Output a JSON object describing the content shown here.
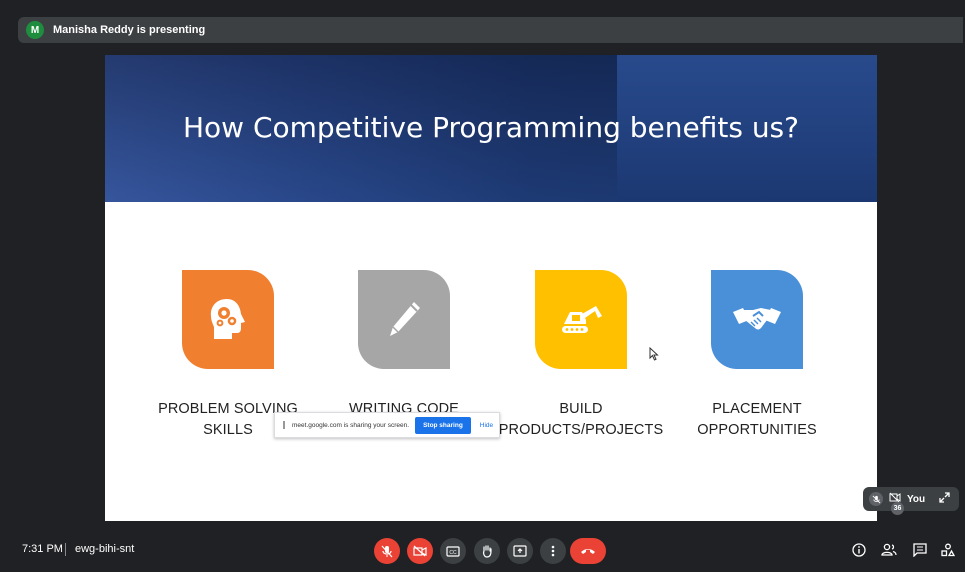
{
  "presenter": {
    "initial": "M",
    "text": "Manisha Reddy is presenting"
  },
  "slide": {
    "title": "How Competitive Programming benefits us?",
    "benefits": [
      {
        "line1": "PROBLEM SOLVING",
        "line2": "SKILLS",
        "icon": "head-gears-icon",
        "color": "#f08030"
      },
      {
        "line1": "WRITING CODE",
        "line2": "",
        "icon": "pencil-icon",
        "color": "#a6a6a6"
      },
      {
        "line1": "BUILD",
        "line2": "PRODUCTS/PROJECTS",
        "icon": "excavator-icon",
        "color": "#ffc000"
      },
      {
        "line1": "PLACEMENT",
        "line2": "OPPORTUNITIES",
        "icon": "handshake-icon",
        "color": "#4a90d9"
      }
    ]
  },
  "share_notice": {
    "message": "meet.google.com is sharing your screen.",
    "stop_label": "Stop sharing",
    "hide_label": "Hide"
  },
  "self_view": {
    "label": "You"
  },
  "bottom_bar": {
    "time": "7:31 PM",
    "meeting_code": "ewg-bihi-snt",
    "participant_count": "36"
  },
  "colors": {
    "background": "#202124",
    "danger": "#ea4335",
    "control_dark": "#3c4043",
    "accent": "#1a73e8"
  }
}
